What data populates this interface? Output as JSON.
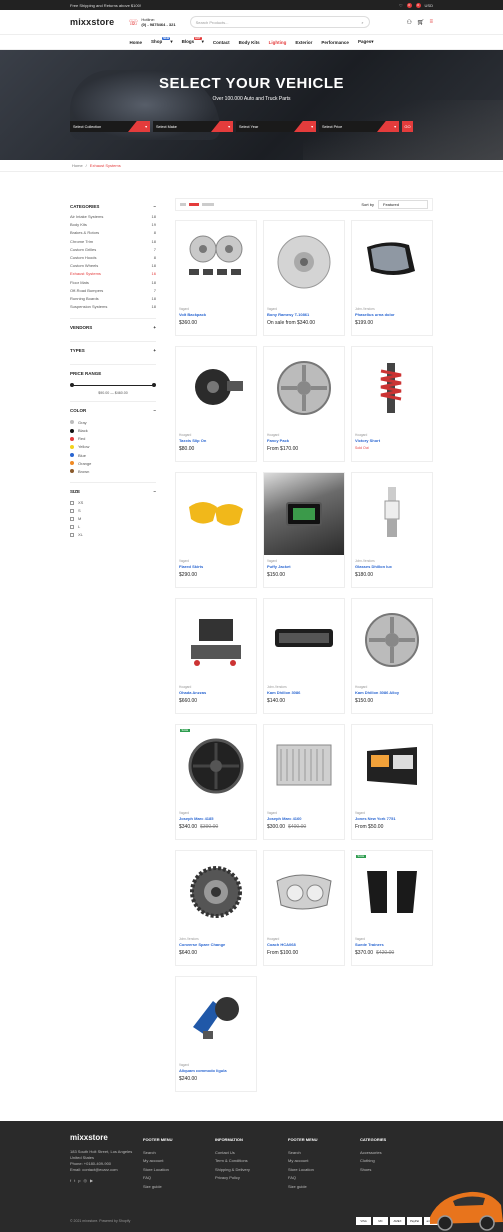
{
  "topbar": {
    "left": "Free Shipping and Returns above $100!",
    "cart_count": "0",
    "wish_count": "0",
    "currency": "USD"
  },
  "header": {
    "logo": "mixxstore",
    "hotline_label": "Hotline:",
    "hotline_number": "(0) - 9875464 - 321",
    "search_placeholder": "Search Products..."
  },
  "nav": [
    {
      "label": "Home",
      "badge": ""
    },
    {
      "label": "Shop",
      "badge": "NEW",
      "chev": "▾"
    },
    {
      "label": "Blogs",
      "badge": "HOT",
      "chev": "▾"
    },
    {
      "label": "Contact",
      "badge": ""
    },
    {
      "label": "Body Kits",
      "badge": ""
    },
    {
      "label": "Lighting",
      "badge": ""
    },
    {
      "label": "Exterior",
      "badge": ""
    },
    {
      "label": "Performance",
      "badge": ""
    },
    {
      "label": "Pages",
      "badge": "",
      "chev": "▾"
    }
  ],
  "hero": {
    "title": "SELECT YOUR VEHICLE",
    "subtitle": "Over 100.000 Auto and Truck Parts",
    "selects": [
      "Select Collection",
      "Select Make",
      "Select Year",
      "Select Price"
    ],
    "go": "GO"
  },
  "breadcrumb": {
    "home": "Home",
    "sep": "/",
    "current": "Exhaust Systems"
  },
  "sidebar": {
    "categories_title": "CATEGORIES",
    "categories": [
      {
        "name": "Air Intake Systems",
        "count": "18"
      },
      {
        "name": "Body Kits",
        "count": "19"
      },
      {
        "name": "Brakes & Rotors",
        "count": "8"
      },
      {
        "name": "Chrome Trim",
        "count": "18"
      },
      {
        "name": "Custom Grilles",
        "count": "7"
      },
      {
        "name": "Custom Hoods",
        "count": "8"
      },
      {
        "name": "Custom Wheels",
        "count": "18"
      },
      {
        "name": "Exhaust Systems",
        "count": "16"
      },
      {
        "name": "Floor Mats",
        "count": "18"
      },
      {
        "name": "Off-Road Bumpers",
        "count": "7"
      },
      {
        "name": "Running Boards",
        "count": "18"
      },
      {
        "name": "Suspension Systems",
        "count": "18"
      }
    ],
    "vendors_title": "VENDORS",
    "types_title": "TYPES",
    "price_title": "PRICE RANGE",
    "price_text": "$90.00 — $460.00",
    "color_title": "COLOR",
    "colors": [
      {
        "name": "Gray",
        "hex": "#bdbdbd"
      },
      {
        "name": "Black",
        "hex": "#111111"
      },
      {
        "name": "Red",
        "hex": "#e43c3c"
      },
      {
        "name": "Yellow",
        "hex": "#f2d21b"
      },
      {
        "name": "Blue",
        "hex": "#2a66d1"
      },
      {
        "name": "Orange",
        "hex": "#f08a24"
      },
      {
        "name": "Brown",
        "hex": "#8a5a2b"
      }
    ],
    "size_title": "SIZE",
    "sizes": [
      "XS",
      "S",
      "M",
      "L",
      "XL"
    ]
  },
  "toolbar": {
    "sort_label": "Sort by",
    "sort_value": "Featured"
  },
  "products": [
    {
      "vendor": "Vagard",
      "title": "Volt Backpack",
      "price": "$360.00",
      "old": "",
      "icon": "brake-kit-icon",
      "tag": ""
    },
    {
      "vendor": "Vagard",
      "title": "Bony Ramesy T-10861",
      "price": "On sale from $340.00",
      "old": "",
      "icon": "rotor-icon",
      "tag": ""
    },
    {
      "vendor": "John-Vendors",
      "title": "Phaselius urna dolor",
      "price": "$199.00",
      "old": "",
      "icon": "mirror-icon",
      "tag": ""
    },
    {
      "vendor": "Hoagard",
      "title": "Taxxis Slip On",
      "price": "$80.00",
      "old": "",
      "icon": "distributor-icon",
      "tag": ""
    },
    {
      "vendor": "Hoagard",
      "title": "Fancy Pack",
      "price": "From $170.00",
      "old": "",
      "icon": "wheel-icon",
      "tag": ""
    },
    {
      "vendor": "Hoagard",
      "title": "Victory Short",
      "price": "",
      "old": "",
      "soldout": "Sold Out",
      "icon": "shock-icon",
      "tag": ""
    },
    {
      "vendor": "Vagard",
      "title": "Flared Skirts",
      "price": "$290.00",
      "old": "",
      "icon": "caliper-icon",
      "tag": ""
    },
    {
      "vendor": "Vagard",
      "title": "Puffy Jacket",
      "price": "$150.00",
      "old": "",
      "icon": "gauge-icon",
      "tag": ""
    },
    {
      "vendor": "John-Vendors",
      "title": "Glasses Dhillon lux",
      "price": "$180.00",
      "old": "",
      "icon": "spark-plug-icon",
      "tag": ""
    },
    {
      "vendor": "Hoagard",
      "title": "Ohada Anzzas",
      "price": "$660.00",
      "old": "",
      "icon": "engine-kit-icon",
      "tag": ""
    },
    {
      "vendor": "John-Vendors",
      "title": "Kam Dhillon 3086",
      "price": "$140.00",
      "old": "",
      "icon": "light-bar-icon",
      "tag": ""
    },
    {
      "vendor": "Hoagard",
      "title": "Kam Dhillon 3086 Alloy",
      "price": "$150.00",
      "old": "",
      "icon": "rim-icon",
      "tag": ""
    },
    {
      "vendor": "Vagard",
      "title": "Joseph Marc 4185",
      "price": "$340.00",
      "old": "$390.00",
      "icon": "black-rim-icon",
      "tag": "SALE"
    },
    {
      "vendor": "Vagard",
      "title": "Joseph Marc 4160",
      "price": "$300.00",
      "old": "$400.00",
      "icon": "radiator-icon",
      "tag": ""
    },
    {
      "vendor": "Vagard",
      "title": "Jones New York 7751",
      "price": "From $50.00",
      "old": "",
      "icon": "headlight-icon",
      "tag": ""
    },
    {
      "vendor": "John-Vendors",
      "title": "Converse Spare Change",
      "price": "$640.00",
      "old": "",
      "icon": "gear-sprocket-icon",
      "tag": ""
    },
    {
      "vendor": "Hoagard",
      "title": "Coach HCA068",
      "price": "From $100.00",
      "old": "",
      "icon": "lamp-icon",
      "tag": ""
    },
    {
      "vendor": "Vagard",
      "title": "Suede Trainers",
      "price": "$370.00",
      "old": "$420.00",
      "icon": "taillight-icon",
      "tag": "SALE"
    },
    {
      "vendor": "Vagard",
      "title": "Aliquam commodo ligula",
      "price": "$240.00",
      "old": "",
      "icon": "air-intake-icon",
      "tag": ""
    }
  ],
  "footer": {
    "logo": "mixxstore",
    "address": "183 South Holt Street, Los Angeles United States",
    "phone": "Phone: +0180-409-900",
    "email": "Email: contact@ecarz.com",
    "col1": {
      "title": "FOOTER MENU",
      "items": [
        "Search",
        "My account",
        "Store Location",
        "FAQ",
        "Size guide"
      ]
    },
    "col2": {
      "title": "INFORMATION",
      "items": [
        "Contact Us",
        "Term & Conditions",
        "Shipping & Delivery",
        "Privacy Policy"
      ]
    },
    "col3": {
      "title": "FOOTER MENU",
      "items": [
        "Search",
        "My account",
        "Store Location",
        "FAQ",
        "Size guide"
      ]
    },
    "col4": {
      "title": "CATEGORIES",
      "items": [
        "Accessories",
        "Clothing",
        "Shoes"
      ]
    },
    "copyright": "© 2021 mixxstore. Powered by Shopify",
    "payments": [
      "VISA",
      "MC",
      "AMEX",
      "PayPal",
      "amazon"
    ]
  }
}
